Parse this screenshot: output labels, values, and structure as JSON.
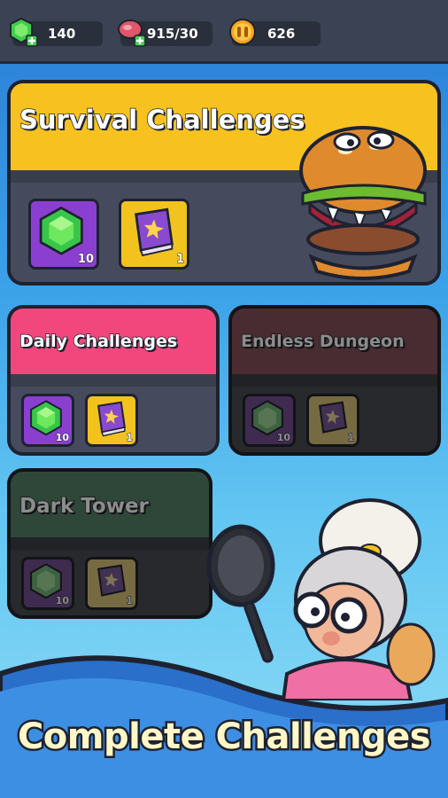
{
  "resources": {
    "gems": "140",
    "meat": "915/30",
    "coins": "626"
  },
  "cards": {
    "survival": {
      "title": "Survival Challenges",
      "gem_count": "10",
      "book_count": "1",
      "header_color": "#f7c21f"
    },
    "daily": {
      "title": "Daily Challenges",
      "gem_count": "10",
      "book_count": "1",
      "header_color": "#f2477c"
    },
    "endless": {
      "title": "Endless Dungeon",
      "gem_count": "10",
      "book_count": "1",
      "header_color": "#6e2635"
    },
    "tower": {
      "title": "Dark Tower",
      "gem_count": "10",
      "book_count": "1",
      "header_color": "#1e6a3e"
    }
  },
  "banner": {
    "text": "Complete Challenges"
  },
  "icons": [
    "gem-plus-icon",
    "meat-plus-icon",
    "coin-icon",
    "gem-icon",
    "spellbook-icon",
    "burger-monster-icon",
    "granny-chef-icon",
    "frying-pan-icon"
  ]
}
